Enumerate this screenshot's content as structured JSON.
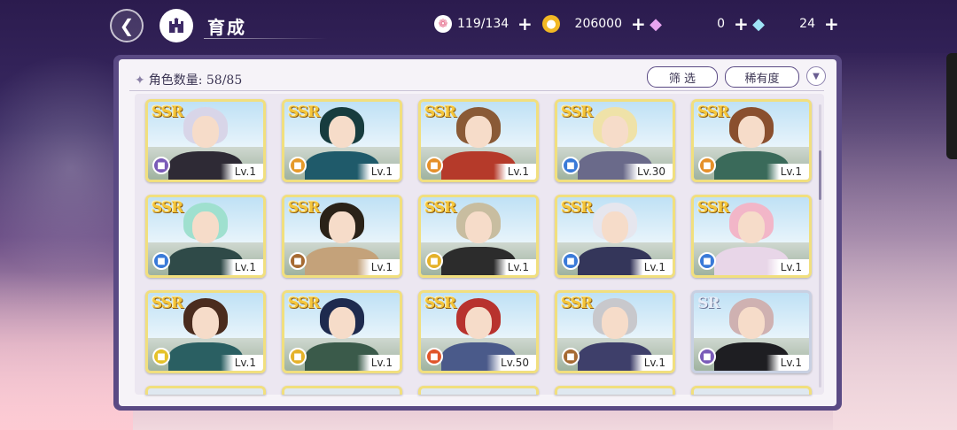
{
  "header": {
    "title": "育成",
    "resources": [
      {
        "name": "candy",
        "icon": "candy-icon",
        "value": "119/134",
        "color": "#e56a8a"
      },
      {
        "name": "coin",
        "icon": "gold-coin-icon",
        "value": "206000",
        "color": "#f2b824"
      },
      {
        "name": "pink-diamond",
        "icon": "pink-diamond-icon",
        "value": "0",
        "color": "#d56ad8"
      },
      {
        "name": "blue-diamond",
        "icon": "blue-diamond-icon",
        "value": "24",
        "color": "#7fd3f0"
      }
    ]
  },
  "panel": {
    "count_label": "角色数量: 58/85",
    "filter_label": "筛 选",
    "rarity_label": "稀有度"
  },
  "cards": [
    {
      "rarity": "SSR",
      "level": "Lv.1",
      "element_color": "#7a5bb8",
      "hair": "#d8d5e8",
      "outfit": "#2e2a35"
    },
    {
      "rarity": "SSR",
      "level": "Lv.1",
      "element_color": "#e59a2a",
      "hair": "#173c3e",
      "outfit": "#1f5a6a"
    },
    {
      "rarity": "SSR",
      "level": "Lv.1",
      "element_color": "#e5902a",
      "hair": "#8a5a36",
      "outfit": "#b53a2a"
    },
    {
      "rarity": "SSR",
      "level": "Lv.30",
      "element_color": "#3a7ad8",
      "hair": "#efe2a8",
      "outfit": "#6a6a8a"
    },
    {
      "rarity": "SSR",
      "level": "Lv.1",
      "element_color": "#e5902a",
      "hair": "#8a4f2e",
      "outfit": "#3a6a5a"
    },
    {
      "rarity": "SSR",
      "level": "Lv.1",
      "element_color": "#3a7ad8",
      "hair": "#9fe0cf",
      "outfit": "#2f4a48"
    },
    {
      "rarity": "SSR",
      "level": "Lv.1",
      "element_color": "#a66a32",
      "hair": "#2a2218",
      "outfit": "#c4a27a"
    },
    {
      "rarity": "SSR",
      "level": "Lv.1",
      "element_color": "#e5b22a",
      "hair": "#c8bda0",
      "outfit": "#2c2c2c"
    },
    {
      "rarity": "SSR",
      "level": "Lv.1",
      "element_color": "#3a7ad8",
      "hair": "#e6e6ee",
      "outfit": "#34365a"
    },
    {
      "rarity": "SSR",
      "level": "Lv.1",
      "element_color": "#3a7ad8",
      "hair": "#f2b6c8",
      "outfit": "#e8d6e8"
    },
    {
      "rarity": "SSR",
      "level": "Lv.1",
      "element_color": "#e5c22a",
      "hair": "#4a2c1e",
      "outfit": "#2a5f62"
    },
    {
      "rarity": "SSR",
      "level": "Lv.1",
      "element_color": "#e5b22a",
      "hair": "#1e2a4e",
      "outfit": "#3a5a4a"
    },
    {
      "rarity": "SSR",
      "level": "Lv.50",
      "element_color": "#e0552a",
      "hair": "#b8322e",
      "outfit": "#4a5a8a"
    },
    {
      "rarity": "SSR",
      "level": "Lv.1",
      "element_color": "#a66a32",
      "hair": "#c8c8cc",
      "outfit": "#3e3f6a"
    },
    {
      "rarity": "SR",
      "level": "Lv.1",
      "element_color": "#7a5bb8",
      "hair": "#cfb1b1",
      "outfit": "#1e1e22"
    }
  ]
}
